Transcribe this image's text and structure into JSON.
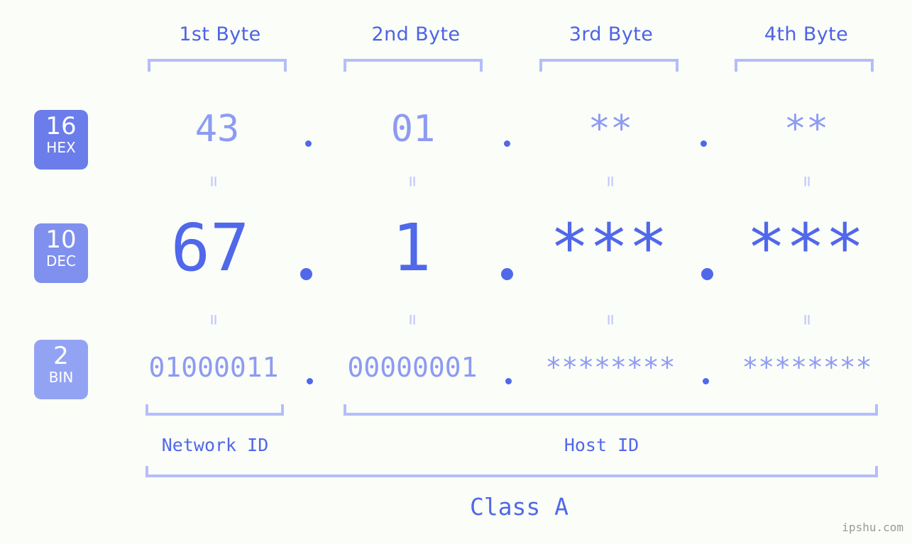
{
  "meta": {
    "watermark": "ipshu.com",
    "accent_strong": "#5068ea",
    "accent_soft": "#8d9bf2",
    "accent_line": "#b4bdfa",
    "background": "#fbfdf8"
  },
  "byte_headers": [
    {
      "label": "1st Byte"
    },
    {
      "label": "2nd Byte"
    },
    {
      "label": "3rd Byte"
    },
    {
      "label": "4th Byte"
    }
  ],
  "radix_badges": [
    {
      "number": "16",
      "name": "HEX",
      "color": "#6b7ceb"
    },
    {
      "number": "10",
      "name": "DEC",
      "color": "#7f90ee"
    },
    {
      "number": "2",
      "name": "BIN",
      "color": "#93a3f4"
    }
  ],
  "rows": {
    "hex": {
      "radix": "16",
      "values": [
        "43",
        "01",
        "**",
        "**"
      ],
      "separators": [
        ".",
        ".",
        "."
      ]
    },
    "dec": {
      "radix": "10",
      "values": [
        "67",
        "1",
        "***",
        "***"
      ],
      "separators": [
        ".",
        ".",
        "."
      ]
    },
    "bin": {
      "radix": "2",
      "values": [
        "01000011",
        "00000001",
        "********",
        "********"
      ],
      "separators": [
        ".",
        ".",
        "."
      ]
    }
  },
  "equals_marks": {
    "symbol": "=",
    "hex_to_dec": [
      "=",
      "=",
      "=",
      "="
    ],
    "dec_to_bin": [
      "=",
      "=",
      "=",
      "="
    ]
  },
  "regions": [
    {
      "label": "Network ID"
    },
    {
      "label": "Host ID"
    }
  ],
  "class": {
    "label": "Class A"
  }
}
